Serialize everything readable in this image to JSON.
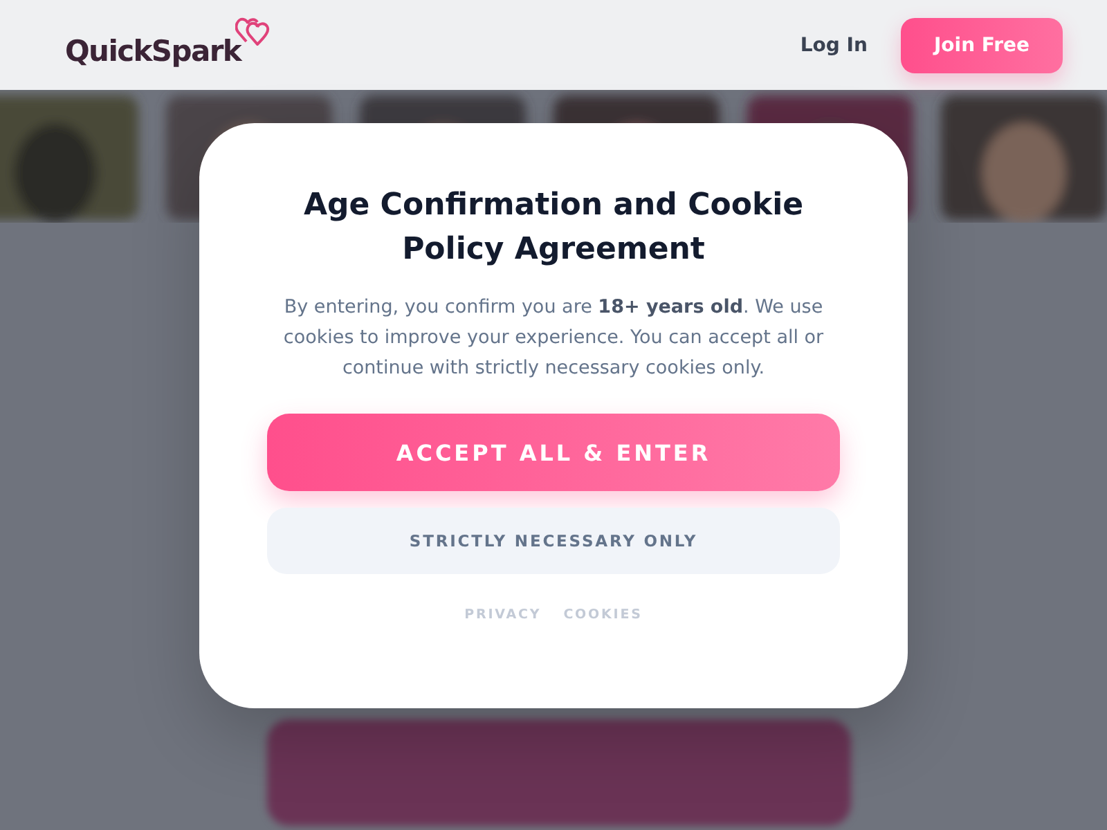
{
  "header": {
    "logo": "QuickSpark",
    "links": [
      {
        "label": "Log In",
        "kind": "link"
      },
      {
        "label": "Join Free",
        "kind": "primary"
      }
    ]
  },
  "modal": {
    "title": "Age Confirmation and Cookie Policy Agreement",
    "text": "By entering, you confirm you are **18+ years old**. We use cookies to improve your experience. You can accept all or continue with strictly necessary cookies only.",
    "buttons": [
      {
        "label": "ACCEPT ALL & ENTER",
        "kind": "primary"
      },
      {
        "label": "STRICTLY NECESSARY ONLY",
        "kind": "secondary"
      }
    ],
    "links": [
      "PRIVACY",
      "COOKIES"
    ]
  }
}
